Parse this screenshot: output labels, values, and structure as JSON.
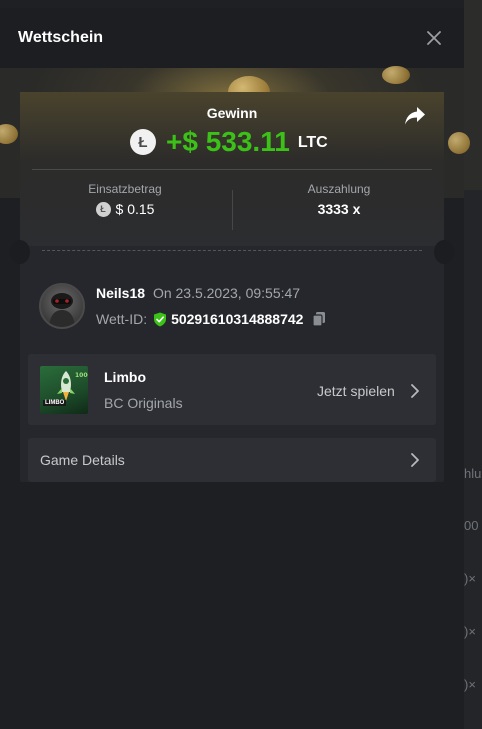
{
  "modal": {
    "title": "Wettschein",
    "close_icon": "close-icon"
  },
  "win": {
    "label": "Gewinn",
    "amount": "+$ 533.11",
    "currency": "LTC",
    "coin_icon": "litecoin-icon",
    "share_icon": "share-icon",
    "accent_color": "#3bc117"
  },
  "stats": {
    "bet_amount_label": "Einsatzbetrag",
    "bet_amount_value": "$ 0.15",
    "payout_label": "Auszahlung",
    "payout_value": "3333 x"
  },
  "bet": {
    "username": "Neils18",
    "time": "On 23.5.2023, 09:55:47",
    "id_label": "Wett-ID:",
    "id_value": "50291610314888742",
    "verified_icon": "shield-check-icon",
    "copy_icon": "copy-icon"
  },
  "game": {
    "name": "Limbo",
    "provider": "BC Originals",
    "play_label": "Jetzt spielen",
    "thumb_text": "LIMBO"
  },
  "details": {
    "label": "Game Details"
  },
  "background_peek": [
    "hlu",
    "00",
    ")×",
    ")×",
    ")×"
  ]
}
